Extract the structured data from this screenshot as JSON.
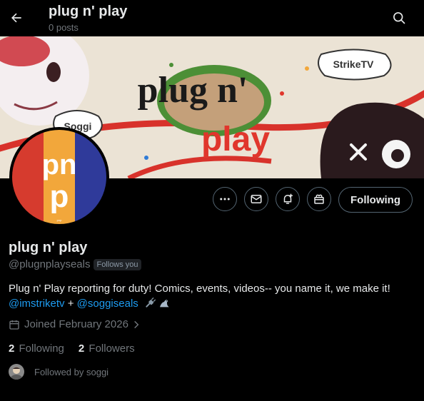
{
  "header": {
    "back_icon": "arrow-left-icon",
    "title": "plug n' play",
    "post_count": "0 posts",
    "search_icon": "search-icon"
  },
  "banner": {
    "logo_text_line1": "plug n'",
    "logo_text_line2": "play",
    "speech_bubble_left": "Soggi",
    "speech_bubble_right": "StrikeTV"
  },
  "avatar": {
    "letters": "pnp",
    "colors": [
      "#d63b2e",
      "#f2a73b",
      "#2f3a9a"
    ]
  },
  "actions": {
    "more_icon": "more-icon",
    "message_icon": "mail-icon",
    "notify_icon": "bell-plus-icon",
    "subscribe_icon": "gift-icon",
    "following_label": "Following"
  },
  "profile": {
    "display_name": "plug n' play",
    "handle": "@plugnplayseals",
    "follows_you": "Follows you",
    "bio_text": "Plug n' Play reporting for duty! Comics, events, videos-- you name it, we make it!",
    "bio_mention_1": "@imstriketv",
    "bio_plus": "+",
    "bio_mention_2": "@soggiseals",
    "joined": "Joined February 2026",
    "following_count": "2",
    "following_label": "Following",
    "followers_count": "2",
    "followers_label": "Followers",
    "followed_by": "Followed by soggi"
  },
  "colors": {
    "background": "#000000",
    "text": "#e7e9ea",
    "secondary_text": "#71767b",
    "link": "#1d9bf0",
    "border": "#536471"
  }
}
